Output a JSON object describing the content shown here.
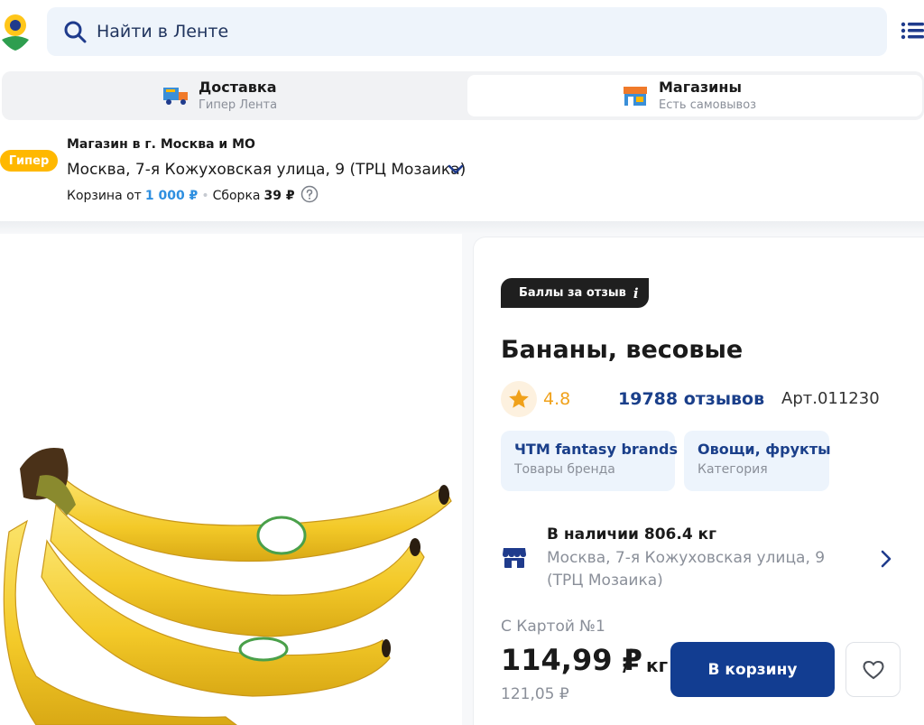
{
  "header": {
    "search_placeholder": "Найти в Ленте"
  },
  "modes": [
    {
      "title": "Доставка",
      "subtitle": "Гипер Лента",
      "icon": "delivery-truck-icon"
    },
    {
      "title": "Магазины",
      "subtitle": "Есть самовывоз",
      "icon": "store-icon"
    }
  ],
  "store": {
    "badge": "Гипер",
    "city": "Магазин в г. Москва и МО",
    "address": "Москва, 7-я Кожуховская улица, 9 (ТРЦ Мозаика)",
    "basket_label": "Корзина от",
    "basket_min": "1 000 ₽",
    "separator": "•",
    "assembly_label": "Сборка",
    "assembly_price": "39 ₽"
  },
  "product": {
    "points_badge": "Баллы за отзыв",
    "points_info": "i",
    "title": "Бананы, весовые",
    "rating": "4.8",
    "reviews": "19788 отзывов",
    "article": "Арт.011230",
    "brand": {
      "title": "ЧТМ fantasy brands",
      "subtitle": "Товары бренда"
    },
    "category": {
      "title": "Овощи, фрукты",
      "subtitle": "Категория"
    },
    "stock_title": "В наличии 806.4 кг",
    "stock_address": "Москва, 7-я Кожуховская улица, 9 (ТРЦ Мозаика)",
    "card_label": "С Картой №1",
    "price": "114,99 ₽",
    "price_sep": "/",
    "price_unit": "кг",
    "old_price": "121,05 ₽",
    "cart_button": "В корзину"
  },
  "colors": {
    "brand_blue": "#123d91",
    "link_blue": "#1a3f8a",
    "accent_yellow": "#ffb800",
    "rating_orange": "#f0a11a"
  }
}
